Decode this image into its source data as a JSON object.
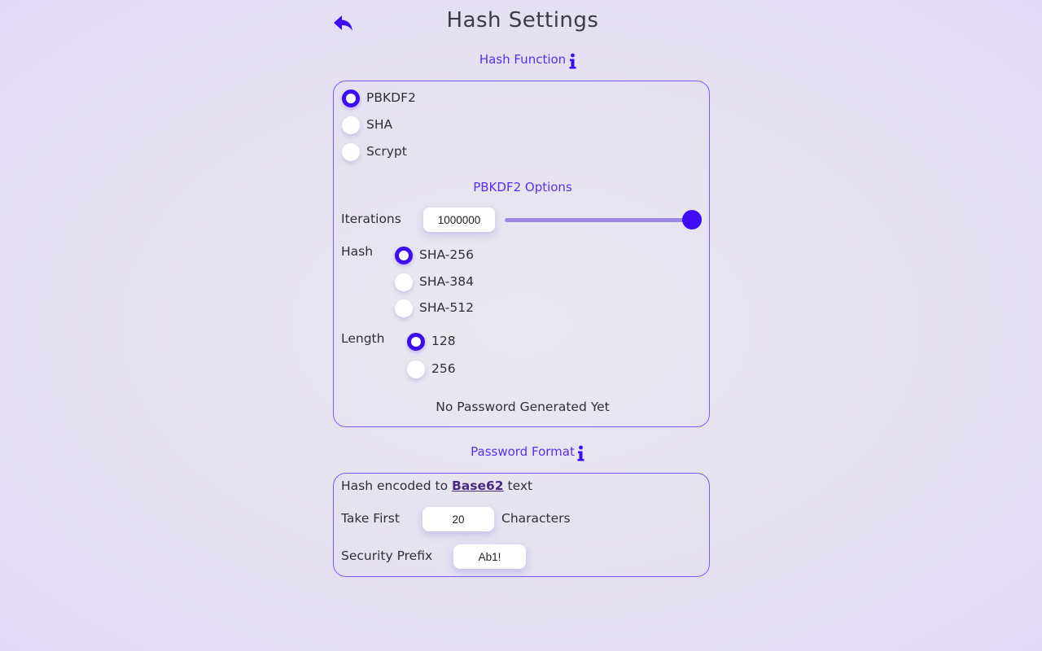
{
  "header": {
    "title": "Hash Settings",
    "back_icon": "back-arrow-icon"
  },
  "hash_function": {
    "title": "Hash Function",
    "info_icon": "info-icon",
    "options": [
      {
        "label": "PBKDF2",
        "checked": true
      },
      {
        "label": "SHA",
        "checked": false
      },
      {
        "label": "Scrypt",
        "checked": false
      }
    ]
  },
  "pbkdf2_options": {
    "title": "PBKDF2 Options",
    "iterations": {
      "label": "Iterations",
      "value": "1000000",
      "slider_fraction": 1.0
    },
    "hash": {
      "label": "Hash",
      "options": [
        {
          "label": "SHA-256",
          "checked": true
        },
        {
          "label": "SHA-384",
          "checked": false
        },
        {
          "label": "SHA-512",
          "checked": false
        }
      ]
    },
    "length": {
      "label": "Length",
      "options": [
        {
          "label": "128",
          "checked": true
        },
        {
          "label": "256",
          "checked": false
        }
      ]
    },
    "status": "No Password Generated Yet"
  },
  "password_format": {
    "title": "Password Format",
    "info_icon": "info-icon",
    "encoding_prefix": "Hash encoded to",
    "encoding_link": "Base62",
    "encoding_suffix": "text",
    "take_first_label": "Take First",
    "take_first_value": "20",
    "characters_label": "Characters",
    "security_prefix_label": "Security Prefix",
    "security_prefix_value": "Ab1!"
  },
  "colors": {
    "accent": "#3d0cf2",
    "section_title": "#5b2cf0",
    "panel_border": "#7b5cf2",
    "slider_track": "#9c88e0"
  }
}
